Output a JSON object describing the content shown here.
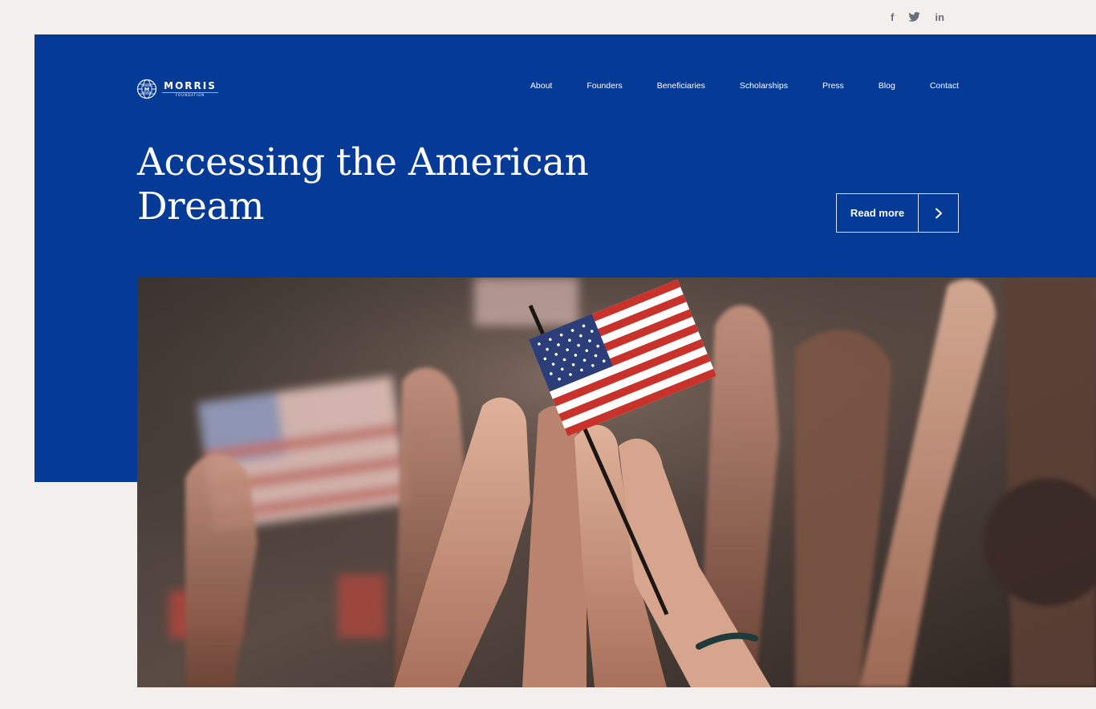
{
  "social": {
    "facebook": "f",
    "twitter_icon": "twitter-bird",
    "linkedin": "in"
  },
  "brand": {
    "name": "MORRIS",
    "sub": "FOUNDATION",
    "mark": "M"
  },
  "nav": {
    "items": [
      "About",
      "Founders",
      "Beneficiaries",
      "Scholarships",
      "Press",
      "Blog",
      "Contact"
    ]
  },
  "hero": {
    "headline_line1": "Accessing the American",
    "headline_line2": "Dream",
    "cta_label": "Read more",
    "cta_icon": "chevron-right-icon",
    "photo_alt": "American flag"
  },
  "colors": {
    "brand_blue": "#063a97",
    "page_bg": "#f2efed",
    "icon_gray": "#6b6f7a"
  }
}
